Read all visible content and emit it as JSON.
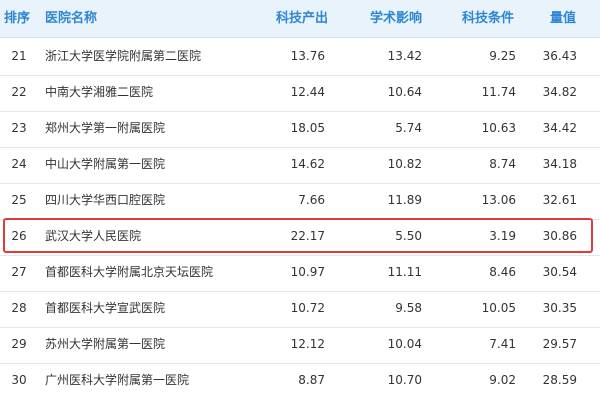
{
  "header": {
    "rank": "排序",
    "name": "医院名称",
    "output": "科技产出",
    "academic": "学术影响",
    "conditions": "科技条件",
    "value": "量值"
  },
  "rows": [
    {
      "rank": "21",
      "name": "浙江大学医学院附属第二医院",
      "output": "13.76",
      "academic": "13.42",
      "conditions": "9.25",
      "value": "36.43"
    },
    {
      "rank": "22",
      "name": "中南大学湘雅二医院",
      "output": "12.44",
      "academic": "10.64",
      "conditions": "11.74",
      "value": "34.82"
    },
    {
      "rank": "23",
      "name": "郑州大学第一附属医院",
      "output": "18.05",
      "academic": "5.74",
      "conditions": "10.63",
      "value": "34.42"
    },
    {
      "rank": "24",
      "name": "中山大学附属第一医院",
      "output": "14.62",
      "academic": "10.82",
      "conditions": "8.74",
      "value": "34.18"
    },
    {
      "rank": "25",
      "name": "四川大学华西口腔医院",
      "output": "7.66",
      "academic": "11.89",
      "conditions": "13.06",
      "value": "32.61"
    },
    {
      "rank": "26",
      "name": "武汉大学人民医院",
      "output": "22.17",
      "academic": "5.50",
      "conditions": "3.19",
      "value": "30.86"
    },
    {
      "rank": "27",
      "name": "首都医科大学附属北京天坛医院",
      "output": "10.97",
      "academic": "11.11",
      "conditions": "8.46",
      "value": "30.54"
    },
    {
      "rank": "28",
      "name": "首都医科大学宣武医院",
      "output": "10.72",
      "academic": "9.58",
      "conditions": "10.05",
      "value": "30.35"
    },
    {
      "rank": "29",
      "name": "苏州大学附属第一医院",
      "output": "12.12",
      "academic": "10.04",
      "conditions": "7.41",
      "value": "29.57"
    },
    {
      "rank": "30",
      "name": "广州医科大学附属第一医院",
      "output": "8.87",
      "academic": "10.70",
      "conditions": "9.02",
      "value": "28.59"
    }
  ],
  "highlighted_rank": "26",
  "colors": {
    "header_text": "#2f86d4",
    "header_bg": "#e9f3fb",
    "highlight_border": "#e03b3b"
  }
}
